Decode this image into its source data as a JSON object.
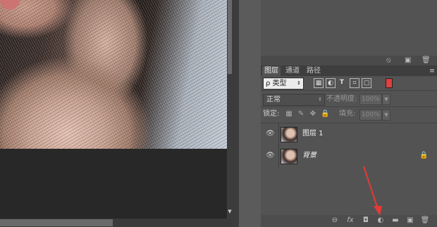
{
  "colors": {
    "accent_red": "#e53935",
    "panel_bg": "#535353",
    "canvas_bg": "#282828"
  },
  "layers_panel": {
    "tabs": [
      {
        "label": "图层",
        "active": true
      },
      {
        "label": "通道",
        "active": false
      },
      {
        "label": "路径",
        "active": false
      }
    ],
    "filter": {
      "label": "ρ 类型"
    },
    "blend_mode": {
      "value": "正常"
    },
    "opacity": {
      "label": "不透明度:",
      "value": "100%"
    },
    "lock": {
      "label": "锁定:"
    },
    "fill": {
      "label": "填充:",
      "value": "100%"
    },
    "layers": [
      {
        "name": "图层 1",
        "visible": true,
        "locked": false,
        "selected": false
      },
      {
        "name": "背景",
        "visible": true,
        "locked": true,
        "selected": false
      }
    ]
  },
  "icons": {
    "eye": "👁",
    "lock": "🔒",
    "link": "⊖",
    "fx": "fx",
    "mask": "◘",
    "adjustment": "◐",
    "folder": "▬",
    "new_layer": "▣",
    "trash": "🗑"
  }
}
